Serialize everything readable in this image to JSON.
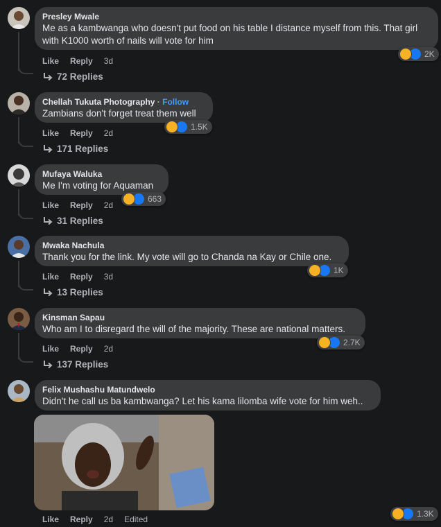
{
  "comments": [
    {
      "author": "Presley Mwale",
      "text": "Me as a kambwanga who doesn't put food on his table I distance myself from this. That girl with K1000 worth of nails will vote for him",
      "reactions": "2K",
      "like_label": "Like",
      "reply_label": "Reply",
      "time": "3d",
      "replies": "72 Replies"
    },
    {
      "author": "Chellah Tukuta Photography",
      "follow_sep": "·",
      "follow": "Follow",
      "text": "Zambians don't forget treat them well",
      "reactions": "1.5K",
      "like_label": "Like",
      "reply_label": "Reply",
      "time": "2d",
      "replies": "171 Replies"
    },
    {
      "author": "Mufaya Waluka",
      "text": "Me I'm voting for Aquaman",
      "reactions": "663",
      "like_label": "Like",
      "reply_label": "Reply",
      "time": "2d",
      "replies": "31 Replies"
    },
    {
      "author": "Mwaka Nachula",
      "text": "Thank you for the link. My vote will go to Chanda na Kay or Chile one.",
      "reactions": "1K",
      "like_label": "Like",
      "reply_label": "Reply",
      "time": "3d",
      "replies": "13 Replies"
    },
    {
      "author": "Kinsman Sapau",
      "text": "Who am I to disregard the will of the majority. These are national matters.",
      "reactions": "2.7K",
      "like_label": "Like",
      "reply_label": "Reply",
      "time": "2d",
      "replies": "137 Replies"
    },
    {
      "author": "Felix Mushashu Matundwelo",
      "text": "Didn't he call us ba kambwanga? Let his kama lilomba wife vote for him weh..",
      "reactions": "1.3K",
      "like_label": "Like",
      "reply_label": "Reply",
      "time": "2d",
      "edited": "Edited"
    }
  ],
  "icons": {
    "reply_arrow": "reply-arrow-icon",
    "haha": "haha-reaction-icon",
    "like": "like-reaction-icon"
  },
  "colors": {
    "background": "#18191a",
    "bubble": "#3a3b3c",
    "follow": "#4599ff",
    "like": "#1877f2",
    "haha": "#f7b125"
  }
}
